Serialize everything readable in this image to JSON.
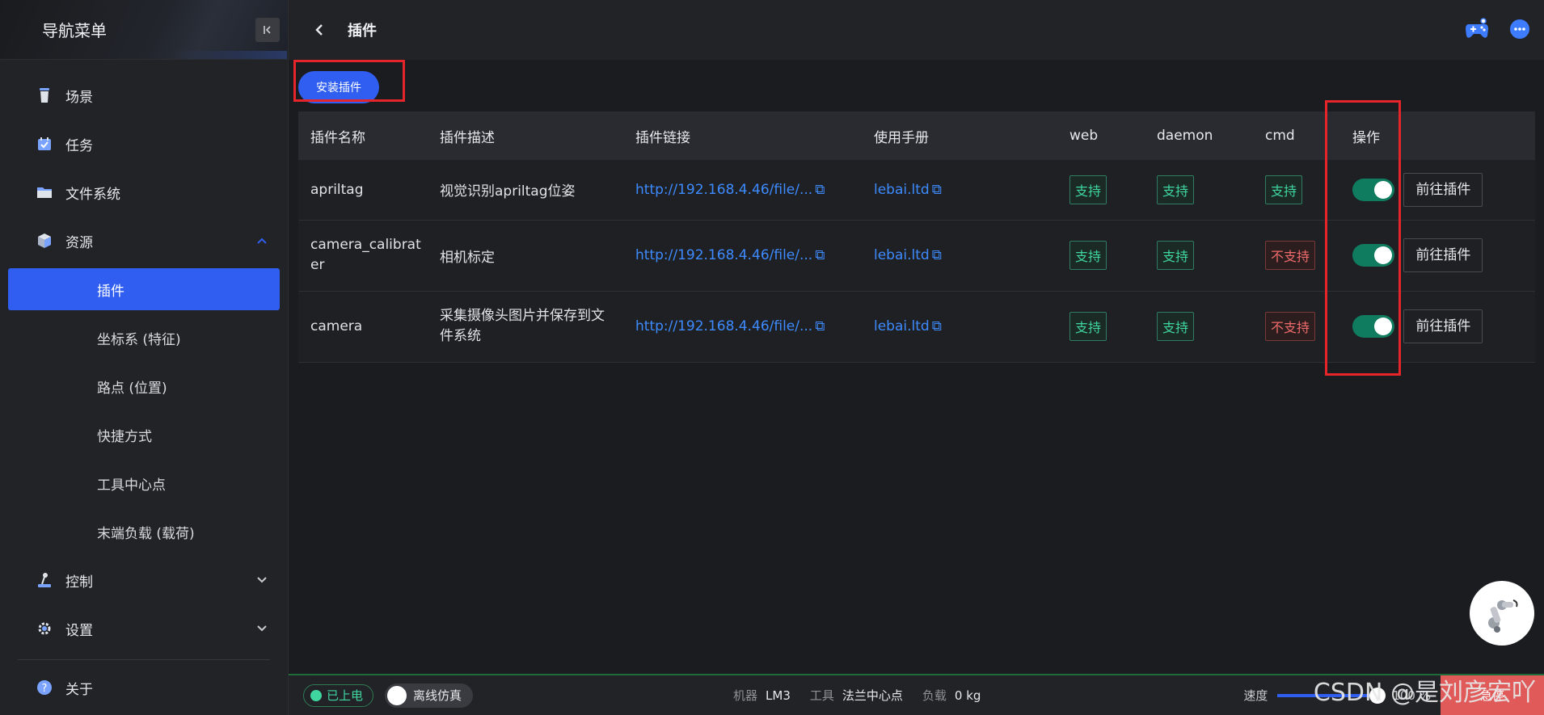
{
  "sidebar": {
    "title": "导航菜单",
    "items": [
      {
        "label": "场景",
        "icon": "cup-icon"
      },
      {
        "label": "任务",
        "icon": "task-icon"
      },
      {
        "label": "文件系统",
        "icon": "folder-icon"
      },
      {
        "label": "资源",
        "icon": "cube-icon"
      }
    ],
    "resource_children": [
      "插件",
      "坐标系 (特征)",
      "路点 (位置)",
      "快捷方式",
      "工具中心点",
      "末端负载 (载荷)"
    ],
    "control_label": "控制",
    "settings_label": "设置",
    "about_label": "关于"
  },
  "topbar": {
    "title": "插件"
  },
  "main": {
    "install_button": "安装插件",
    "columns": [
      "插件名称",
      "插件描述",
      "插件链接",
      "使用手册",
      "web",
      "daemon",
      "cmd",
      "操作"
    ],
    "rows": [
      {
        "name": "apriltag",
        "desc": "视觉识别apriltag位姿",
        "link": "http://192.168.4.46/file/...",
        "manual": "lebai.ltd",
        "web": "支持",
        "daemon": "支持",
        "cmd": "支持",
        "cmd_ok": true,
        "enabled": true,
        "goto": "前往插件"
      },
      {
        "name": "camera_calibrater",
        "desc": "相机标定",
        "link": "http://192.168.4.46/file/...",
        "manual": "lebai.ltd",
        "web": "支持",
        "daemon": "支持",
        "cmd": "不支持",
        "cmd_ok": false,
        "enabled": true,
        "goto": "前往插件"
      },
      {
        "name": "camera",
        "desc": "采集摄像头图片并保存到文件系统",
        "link": "http://192.168.4.46/file/...",
        "manual": "lebai.ltd",
        "web": "支持",
        "daemon": "支持",
        "cmd": "不支持",
        "cmd_ok": false,
        "enabled": true,
        "goto": "前往插件"
      }
    ]
  },
  "statusbar": {
    "power": "已上电",
    "sim": "离线仿真",
    "robot_label": "机器",
    "robot_value": "LM3",
    "tool_label": "工具",
    "tool_value": "法兰中心点",
    "load_label": "负载",
    "load_value": "0 kg",
    "speed_label": "速度",
    "speed_value": "100 %",
    "stop_label": "急停"
  },
  "watermark": "CSDN @是刘彦宏吖",
  "colors": {
    "accent": "#2f5ef0",
    "success": "#3fd6a0",
    "danger": "#f06b6b",
    "toggle_on": "#0f7c5f"
  }
}
